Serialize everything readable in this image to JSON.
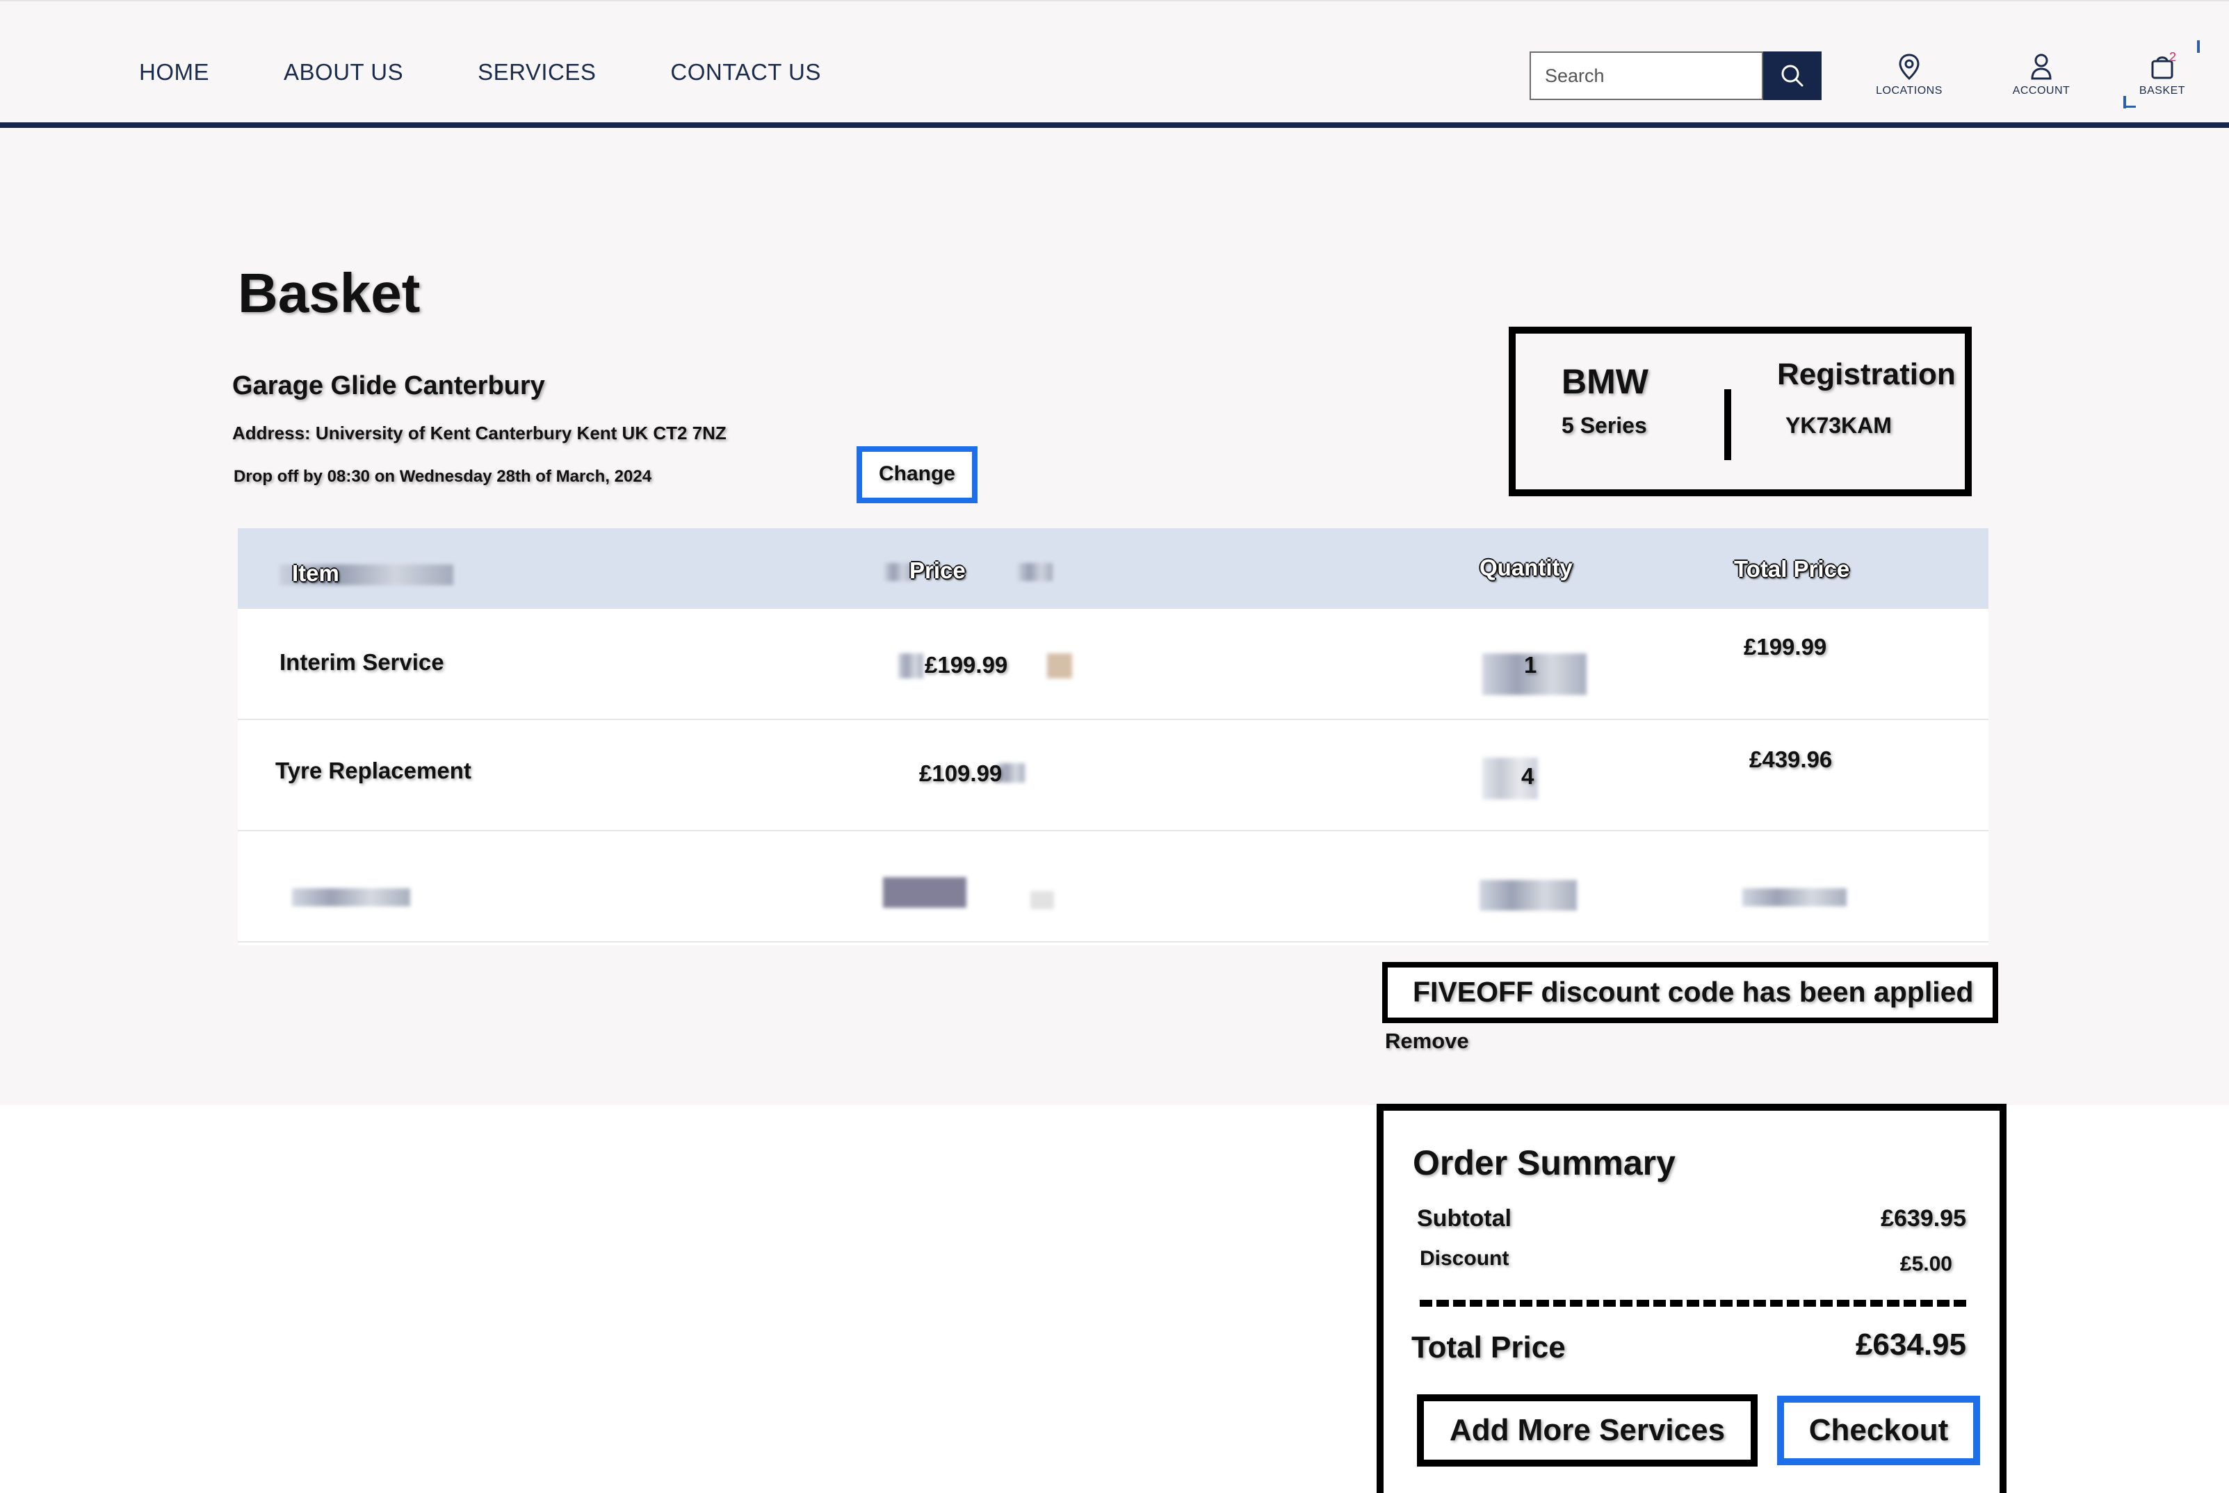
{
  "nav": {
    "links": [
      "HOME",
      "ABOUT US",
      "SERVICES",
      "CONTACT US"
    ],
    "search_placeholder": "Search",
    "icons": {
      "locations_label": "LOCATIONS",
      "account_label": "ACCOUNT",
      "basket_label": "BASKET",
      "basket_count": "2"
    },
    "colors": {
      "navy": "#15264a",
      "badge": "#e0245e"
    }
  },
  "page": {
    "title": "Basket",
    "garage": {
      "name": "Garage Glide Canterbury",
      "address": "Address: University of Kent Canterbury Kent UK CT2 7NZ",
      "dropoff": "Drop off by 08:30 on Wednesday 28th of March, 2024",
      "change_label": "Change"
    },
    "vehicle": {
      "make": "BMW",
      "model": "5 Series",
      "registration_label": "Registration",
      "registration": "YK73KAM"
    }
  },
  "table": {
    "headers": [
      "Item",
      "Price",
      "Quantity",
      "Total Price"
    ],
    "rows": [
      {
        "item": "Interim Service",
        "price": "£199.99",
        "quantity": "1",
        "total": "£199.99"
      },
      {
        "item": "Tyre Replacement",
        "price": "£109.99",
        "quantity": "4",
        "total": "£439.96"
      }
    ]
  },
  "discount": {
    "message": "FIVEOFF discount code has been applied",
    "remove_label": "Remove"
  },
  "summary": {
    "title": "Order Summary",
    "subtotal_label": "Subtotal",
    "subtotal": "£639.95",
    "discount_label": "Discount",
    "discount": "£5.00",
    "total_label": "Total Price",
    "total": "£634.95",
    "add_more_label": "Add More Services",
    "checkout_label": "Checkout"
  }
}
